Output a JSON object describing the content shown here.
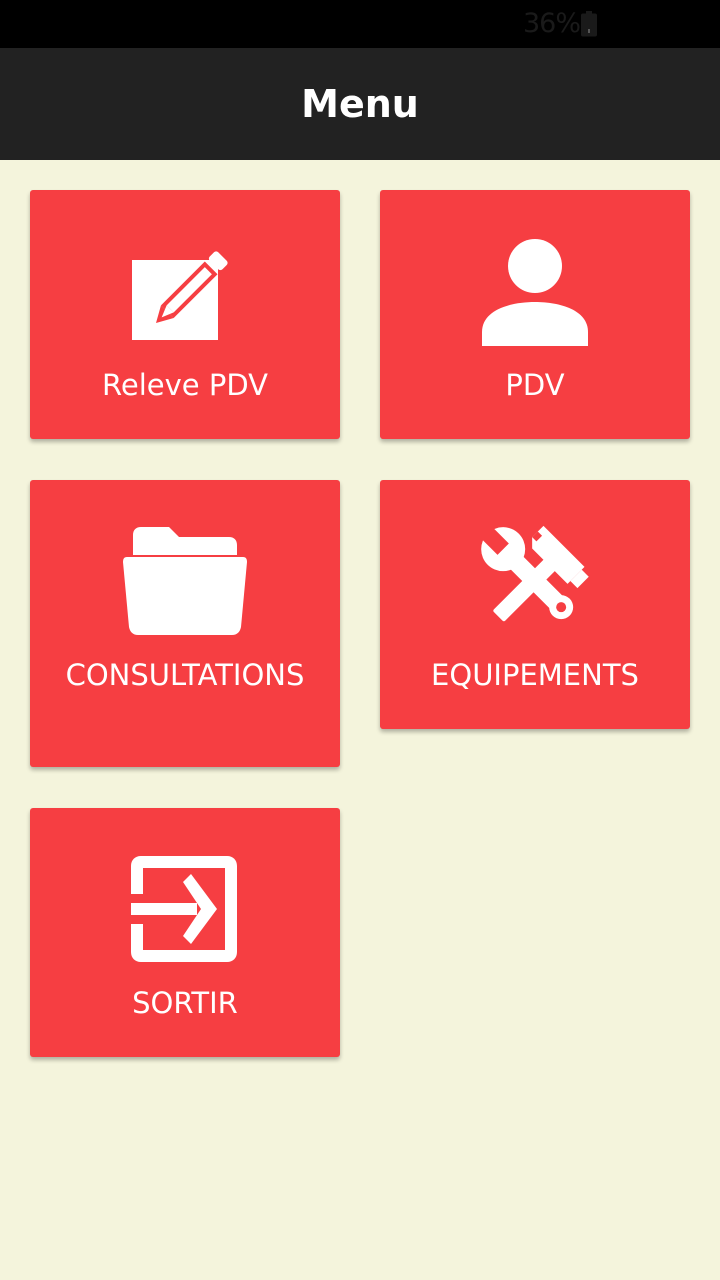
{
  "status_bar": {
    "battery_percent": "36%",
    "icons": [
      "battery-icon"
    ]
  },
  "app_bar": {
    "title": "Menu"
  },
  "tiles": [
    {
      "label": "Releve PDV",
      "icon": "edit-icon"
    },
    {
      "label": "PDV",
      "icon": "person-icon"
    },
    {
      "label": "CONSULTATIONS",
      "icon": "folder-icon"
    },
    {
      "label": "EQUIPEMENTS",
      "icon": "tools-icon"
    },
    {
      "label": "SORTIR",
      "icon": "exit-icon"
    }
  ],
  "colors": {
    "background": "#f4f4dc",
    "app_bar": "#222222",
    "status_bar": "#000000",
    "tile": "#f63e42",
    "text_on_tile": "#ffffff"
  }
}
